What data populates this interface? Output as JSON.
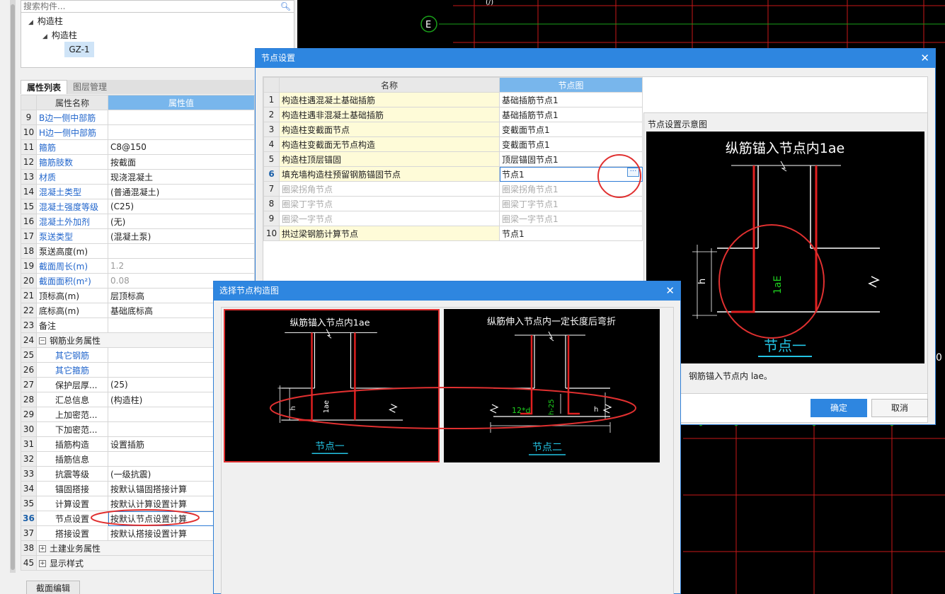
{
  "left_panel": {
    "search_placeholder": "搜索构件...",
    "tree": [
      {
        "label": "构造柱"
      },
      {
        "label": "构造柱"
      },
      {
        "label": "GZ-1"
      }
    ],
    "tabs": [
      "属性列表",
      "图层管理"
    ],
    "table_headers": [
      "属性名称",
      "属性值"
    ],
    "rows": [
      {
        "num": "9",
        "name": "B边一侧中部筋",
        "value": ""
      },
      {
        "num": "10",
        "name": "H边一侧中部筋",
        "value": ""
      },
      {
        "num": "11",
        "name": "箍筋",
        "value": "C8@150"
      },
      {
        "num": "12",
        "name": "箍筋肢数",
        "value": "按截面"
      },
      {
        "num": "13",
        "name": "材质",
        "value": "现浇混凝土"
      },
      {
        "num": "14",
        "name": "混凝土类型",
        "value": "(普通混凝土)"
      },
      {
        "num": "15",
        "name": "混凝土强度等级",
        "value": "(C25)"
      },
      {
        "num": "16",
        "name": "混凝土外加剂",
        "value": "(无)"
      },
      {
        "num": "17",
        "name": "泵送类型",
        "value": "(混凝土泵)"
      },
      {
        "num": "18",
        "name": "泵送高度(m)",
        "value": ""
      },
      {
        "num": "19",
        "name": "截面周长(m)",
        "value": "1.2"
      },
      {
        "num": "20",
        "name": "截面面积(m²)",
        "value": "0.08"
      },
      {
        "num": "21",
        "name": "顶标高(m)",
        "value": "层顶标高"
      },
      {
        "num": "22",
        "name": "底标高(m)",
        "value": "基础底标高"
      },
      {
        "num": "23",
        "name": "备注",
        "value": ""
      },
      {
        "num": "24",
        "name": "钢筋业务属性",
        "value": "",
        "toggle": "−"
      },
      {
        "num": "25",
        "name": "其它钢筋",
        "value": ""
      },
      {
        "num": "26",
        "name": "其它箍筋",
        "value": ""
      },
      {
        "num": "27",
        "name": "保护层厚...",
        "value": "(25)"
      },
      {
        "num": "28",
        "name": "汇总信息",
        "value": "(构造柱)"
      },
      {
        "num": "29",
        "name": "上加密范...",
        "value": ""
      },
      {
        "num": "30",
        "name": "下加密范...",
        "value": ""
      },
      {
        "num": "31",
        "name": "插筋构造",
        "value": "设置插筋"
      },
      {
        "num": "32",
        "name": "插筋信息",
        "value": ""
      },
      {
        "num": "33",
        "name": "抗震等级",
        "value": "(一级抗震)"
      },
      {
        "num": "34",
        "name": "锚固搭接",
        "value": "按默认锚固搭接计算"
      },
      {
        "num": "35",
        "name": "计算设置",
        "value": "按默认计算设置计算"
      },
      {
        "num": "36",
        "name": "节点设置",
        "value": "按默认节点设置计算"
      },
      {
        "num": "37",
        "name": "搭接设置",
        "value": "按默认搭接设置计算"
      },
      {
        "num": "38",
        "name": "土建业务属性",
        "value": "",
        "toggle": "+"
      },
      {
        "num": "45",
        "name": "显示样式",
        "value": "",
        "toggle": "+"
      }
    ],
    "bottom_button": "截面编辑"
  },
  "cad": {
    "axis_label": "E",
    "partial_top": "(/)",
    "partial_right": "0"
  },
  "node_dialog": {
    "title": "节点设置",
    "headers": [
      "名称",
      "节点图"
    ],
    "rows": [
      {
        "num": "1",
        "name": "构造柱遇混凝土基础插筋",
        "node": "基础插筋节点1"
      },
      {
        "num": "2",
        "name": "构造柱遇非混凝土基础插筋",
        "node": "基础插筋节点1"
      },
      {
        "num": "3",
        "name": "构造柱变截面节点",
        "node": "变截面节点1"
      },
      {
        "num": "4",
        "name": "构造柱变截面无节点构造",
        "node": "变截面节点1"
      },
      {
        "num": "5",
        "name": "构造柱顶层锚固",
        "node": "顶层锚固节点1"
      },
      {
        "num": "6",
        "name": "填充墙构造柱预留钢筋锚固节点",
        "node": "节点1"
      },
      {
        "num": "7",
        "name": "圈梁拐角节点",
        "node": "圈梁拐角节点1"
      },
      {
        "num": "8",
        "name": "圈梁丁字节点",
        "node": "圈梁丁字节点1"
      },
      {
        "num": "9",
        "name": "圈梁一字节点",
        "node": "圈梁一字节点1"
      },
      {
        "num": "10",
        "name": "拱过梁钢筋计算节点",
        "node": "节点1"
      }
    ],
    "preview_label": "节点设置示意图",
    "preview_title": "纵筋锚入节点内1ae",
    "preview_caption": "节点一",
    "preview_dim_h": "h",
    "preview_dim_lae": "1aE",
    "description": "钢筋锚入节点内 lae。",
    "ok": "确定",
    "cancel": "取消"
  },
  "select_dialog": {
    "title": "选择节点构造图",
    "options": [
      {
        "title": "纵筋锚入节点内1ae",
        "caption": "节点一",
        "dim_h": "h",
        "dim_lae": "1ae"
      },
      {
        "title": "纵筋伸入节点内一定长度后弯折",
        "caption": "节点二",
        "dim_12d": "12*d",
        "dim_h25": "h-25",
        "dim_h": "h"
      }
    ]
  },
  "colors": {
    "accent": "#2e86e0",
    "annotation_red": "#e03030",
    "name_cell": "#fefbd8",
    "cad_grid": "#c81818",
    "cad_axis": "#1aa01a"
  }
}
